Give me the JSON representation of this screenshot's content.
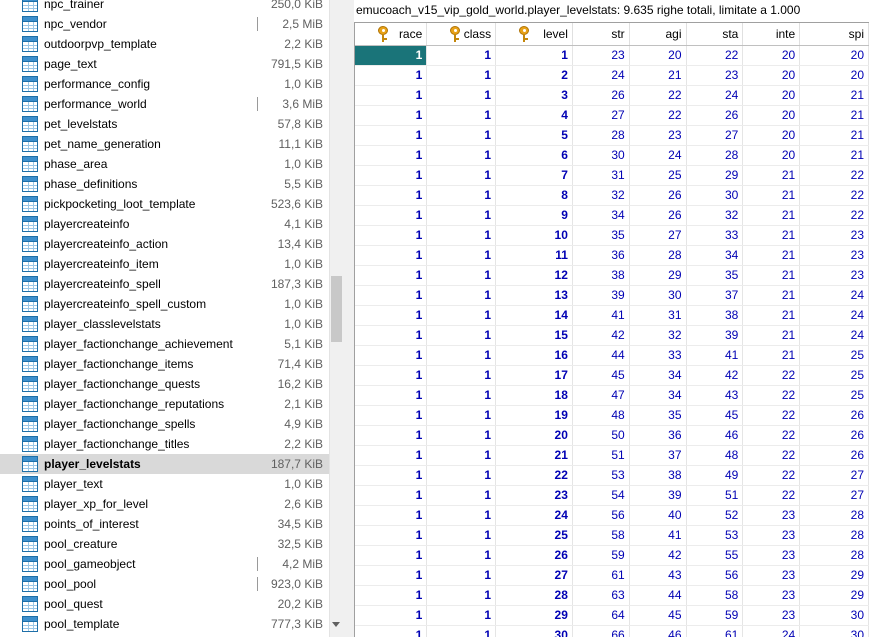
{
  "tree": {
    "items": [
      {
        "name": "npc_trainer",
        "size": "250,0 KiB"
      },
      {
        "name": "npc_vendor",
        "size": "2,5 MiB"
      },
      {
        "name": "outdoorpvp_template",
        "size": "2,2 KiB"
      },
      {
        "name": "page_text",
        "size": "791,5 KiB"
      },
      {
        "name": "performance_config",
        "size": "1,0 KiB"
      },
      {
        "name": "performance_world",
        "size": "3,6 MiB"
      },
      {
        "name": "pet_levelstats",
        "size": "57,8 KiB"
      },
      {
        "name": "pet_name_generation",
        "size": "11,1 KiB"
      },
      {
        "name": "phase_area",
        "size": "1,0 KiB"
      },
      {
        "name": "phase_definitions",
        "size": "5,5 KiB"
      },
      {
        "name": "pickpocketing_loot_template",
        "size": "523,6 KiB"
      },
      {
        "name": "playercreateinfo",
        "size": "4,1 KiB"
      },
      {
        "name": "playercreateinfo_action",
        "size": "13,4 KiB"
      },
      {
        "name": "playercreateinfo_item",
        "size": "1,0 KiB"
      },
      {
        "name": "playercreateinfo_spell",
        "size": "187,3 KiB"
      },
      {
        "name": "playercreateinfo_spell_custom",
        "size": "1,0 KiB"
      },
      {
        "name": "player_classlevelstats",
        "size": "1,0 KiB"
      },
      {
        "name": "player_factionchange_achievement",
        "size": "5,1 KiB"
      },
      {
        "name": "player_factionchange_items",
        "size": "71,4 KiB"
      },
      {
        "name": "player_factionchange_quests",
        "size": "16,2 KiB"
      },
      {
        "name": "player_factionchange_reputations",
        "size": "2,1 KiB"
      },
      {
        "name": "player_factionchange_spells",
        "size": "4,9 KiB"
      },
      {
        "name": "player_factionchange_titles",
        "size": "2,2 KiB"
      },
      {
        "name": "player_levelstats",
        "size": "187,7 KiB"
      },
      {
        "name": "player_text",
        "size": "1,0 KiB"
      },
      {
        "name": "player_xp_for_level",
        "size": "2,6 KiB"
      },
      {
        "name": "points_of_interest",
        "size": "34,5 KiB"
      },
      {
        "name": "pool_creature",
        "size": "32,5 KiB"
      },
      {
        "name": "pool_gameobject",
        "size": "4,2 MiB"
      },
      {
        "name": "pool_pool",
        "size": "923,0 KiB"
      },
      {
        "name": "pool_quest",
        "size": "20,2 KiB"
      },
      {
        "name": "pool_template",
        "size": "777,3 KiB"
      }
    ]
  },
  "grid": {
    "title": "emucoach_v15_vip_gold_world.player_levelstats: 9.635 righe totali, limitate a 1.000",
    "columns": [
      "race",
      "class",
      "level",
      "str",
      "agi",
      "sta",
      "inte",
      "spi"
    ],
    "rows": [
      [
        "1",
        "1",
        "1",
        "23",
        "20",
        "22",
        "20",
        "20"
      ],
      [
        "1",
        "1",
        "2",
        "24",
        "21",
        "23",
        "20",
        "20"
      ],
      [
        "1",
        "1",
        "3",
        "26",
        "22",
        "24",
        "20",
        "21"
      ],
      [
        "1",
        "1",
        "4",
        "27",
        "22",
        "26",
        "20",
        "21"
      ],
      [
        "1",
        "1",
        "5",
        "28",
        "23",
        "27",
        "20",
        "21"
      ],
      [
        "1",
        "1",
        "6",
        "30",
        "24",
        "28",
        "20",
        "21"
      ],
      [
        "1",
        "1",
        "7",
        "31",
        "25",
        "29",
        "21",
        "22"
      ],
      [
        "1",
        "1",
        "8",
        "32",
        "26",
        "30",
        "21",
        "22"
      ],
      [
        "1",
        "1",
        "9",
        "34",
        "26",
        "32",
        "21",
        "22"
      ],
      [
        "1",
        "1",
        "10",
        "35",
        "27",
        "33",
        "21",
        "23"
      ],
      [
        "1",
        "1",
        "11",
        "36",
        "28",
        "34",
        "21",
        "23"
      ],
      [
        "1",
        "1",
        "12",
        "38",
        "29",
        "35",
        "21",
        "23"
      ],
      [
        "1",
        "1",
        "13",
        "39",
        "30",
        "37",
        "21",
        "24"
      ],
      [
        "1",
        "1",
        "14",
        "41",
        "31",
        "38",
        "21",
        "24"
      ],
      [
        "1",
        "1",
        "15",
        "42",
        "32",
        "39",
        "21",
        "24"
      ],
      [
        "1",
        "1",
        "16",
        "44",
        "33",
        "41",
        "21",
        "25"
      ],
      [
        "1",
        "1",
        "17",
        "45",
        "34",
        "42",
        "22",
        "25"
      ],
      [
        "1",
        "1",
        "18",
        "47",
        "34",
        "43",
        "22",
        "25"
      ],
      [
        "1",
        "1",
        "19",
        "48",
        "35",
        "45",
        "22",
        "26"
      ],
      [
        "1",
        "1",
        "20",
        "50",
        "36",
        "46",
        "22",
        "26"
      ],
      [
        "1",
        "1",
        "21",
        "51",
        "37",
        "48",
        "22",
        "26"
      ],
      [
        "1",
        "1",
        "22",
        "53",
        "38",
        "49",
        "22",
        "27"
      ],
      [
        "1",
        "1",
        "23",
        "54",
        "39",
        "51",
        "22",
        "27"
      ],
      [
        "1",
        "1",
        "24",
        "56",
        "40",
        "52",
        "23",
        "28"
      ],
      [
        "1",
        "1",
        "25",
        "58",
        "41",
        "53",
        "23",
        "28"
      ],
      [
        "1",
        "1",
        "26",
        "59",
        "42",
        "55",
        "23",
        "28"
      ],
      [
        "1",
        "1",
        "27",
        "61",
        "43",
        "56",
        "23",
        "29"
      ],
      [
        "1",
        "1",
        "28",
        "63",
        "44",
        "58",
        "23",
        "29"
      ],
      [
        "1",
        "1",
        "29",
        "64",
        "45",
        "59",
        "23",
        "30"
      ],
      [
        "1",
        "1",
        "30",
        "66",
        "46",
        "61",
        "24",
        "30"
      ]
    ]
  }
}
